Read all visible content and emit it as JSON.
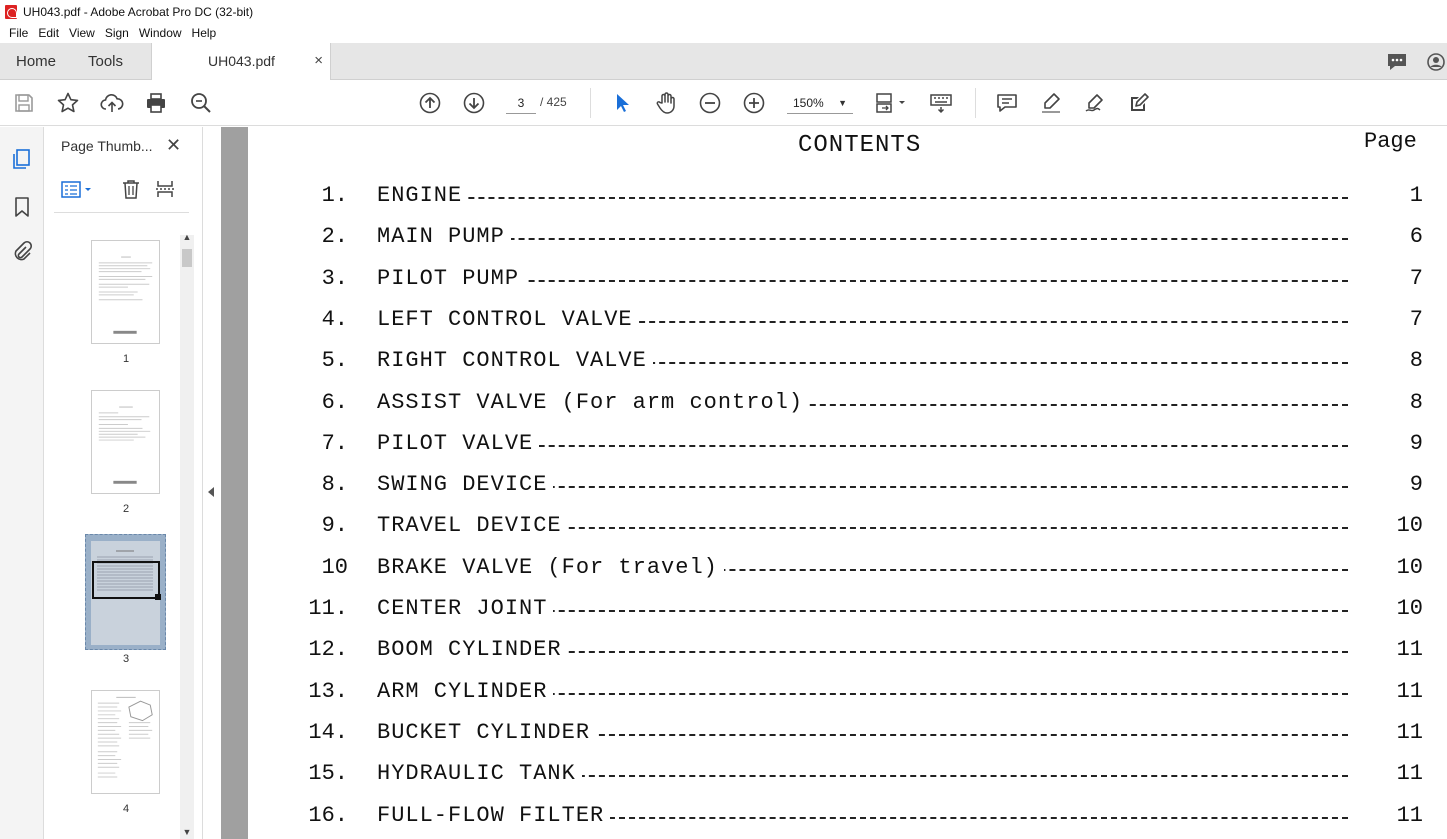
{
  "window": {
    "title": "UH043.pdf - Adobe Acrobat Pro DC (32-bit)"
  },
  "menu": [
    "File",
    "Edit",
    "View",
    "Sign",
    "Window",
    "Help"
  ],
  "tabs": {
    "home": "Home",
    "tools": "Tools",
    "document": "UH043.pdf",
    "close_symbol": "×"
  },
  "toolbar": {
    "page_current": "3",
    "page_total": "/ 425",
    "zoom": "150%",
    "icons": [
      "save-icon",
      "star-icon",
      "upload-icon",
      "print-icon",
      "search-zoom-icon",
      "page-up-icon",
      "page-down-icon",
      "select-cursor-icon",
      "hand-icon",
      "zoom-out-icon",
      "zoom-in-icon",
      "page-layout-icon",
      "keyboard-icon",
      "comment-icon",
      "highlight-icon",
      "sign-icon",
      "edit-icon"
    ]
  },
  "thumbnails_panel": {
    "title": "Page Thumb...",
    "close_symbol": "✕",
    "pages": [
      {
        "label": "1"
      },
      {
        "label": "2"
      },
      {
        "label": "3",
        "selected": true
      },
      {
        "label": "4"
      }
    ]
  },
  "document": {
    "title": "CONTENTS",
    "page_header": "Page",
    "toc": [
      {
        "num": "1.",
        "title": "ENGINE",
        "page": "1"
      },
      {
        "num": "2.",
        "title": "MAIN PUMP",
        "page": "6"
      },
      {
        "num": "3.",
        "title": "PILOT PUMP",
        "page": "7"
      },
      {
        "num": "4.",
        "title": "LEFT CONTROL VALVE",
        "page": "7"
      },
      {
        "num": "5.",
        "title": "RIGHT CONTROL VALVE",
        "page": "8"
      },
      {
        "num": "6.",
        "title": "ASSIST VALVE (For arm control)",
        "page": "8"
      },
      {
        "num": "7.",
        "title": "PILOT VALVE",
        "page": "9"
      },
      {
        "num": "8.",
        "title": "SWING DEVICE",
        "page": "9"
      },
      {
        "num": "9.",
        "title": "TRAVEL DEVICE",
        "page": "10"
      },
      {
        "num": "10",
        "title": "BRAKE VALVE (For travel)",
        "page": "10"
      },
      {
        "num": "11.",
        "title": "CENTER JOINT",
        "page": "10"
      },
      {
        "num": "12.",
        "title": "BOOM CYLINDER",
        "page": "11"
      },
      {
        "num": "13.",
        "title": "ARM CYLINDER",
        "page": "11"
      },
      {
        "num": "14.",
        "title": "BUCKET CYLINDER",
        "page": "11"
      },
      {
        "num": "15.",
        "title": "HYDRAULIC TANK",
        "page": "11"
      },
      {
        "num": "16.",
        "title": "FULL-FLOW FILTER",
        "page": "11"
      }
    ]
  }
}
